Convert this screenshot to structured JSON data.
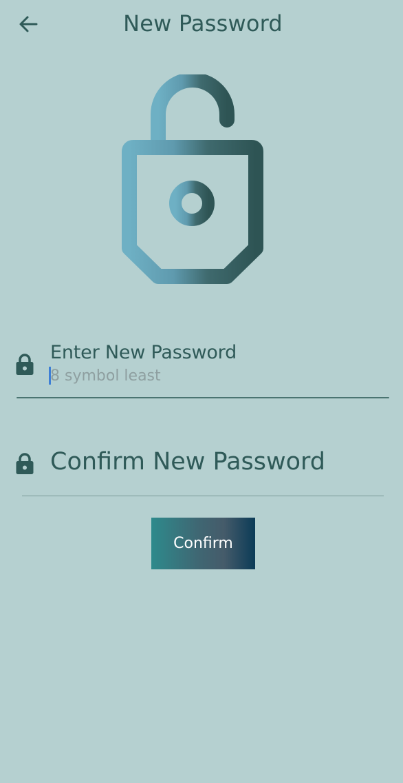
{
  "header": {
    "title": "New Password",
    "back_icon": "arrow-left-icon"
  },
  "hero": {
    "icon": "unlocked-padlock-icon",
    "gradient_colors": [
      "#6eb0c4",
      "#2e5454"
    ]
  },
  "form": {
    "new_password": {
      "icon": "lock-icon",
      "label": "Enter New Password",
      "placeholder": "8 symbol least",
      "value": ""
    },
    "confirm_password": {
      "icon": "lock-icon",
      "placeholder": "Confirm New Password",
      "value": ""
    },
    "confirm_button_label": "Confirm"
  },
  "colors": {
    "background": "#b5d0d0",
    "text_primary": "#2f5a58",
    "cursor": "#3d7fd6",
    "button_gradient": [
      "#2e8a8c",
      "#0b3b57"
    ]
  }
}
